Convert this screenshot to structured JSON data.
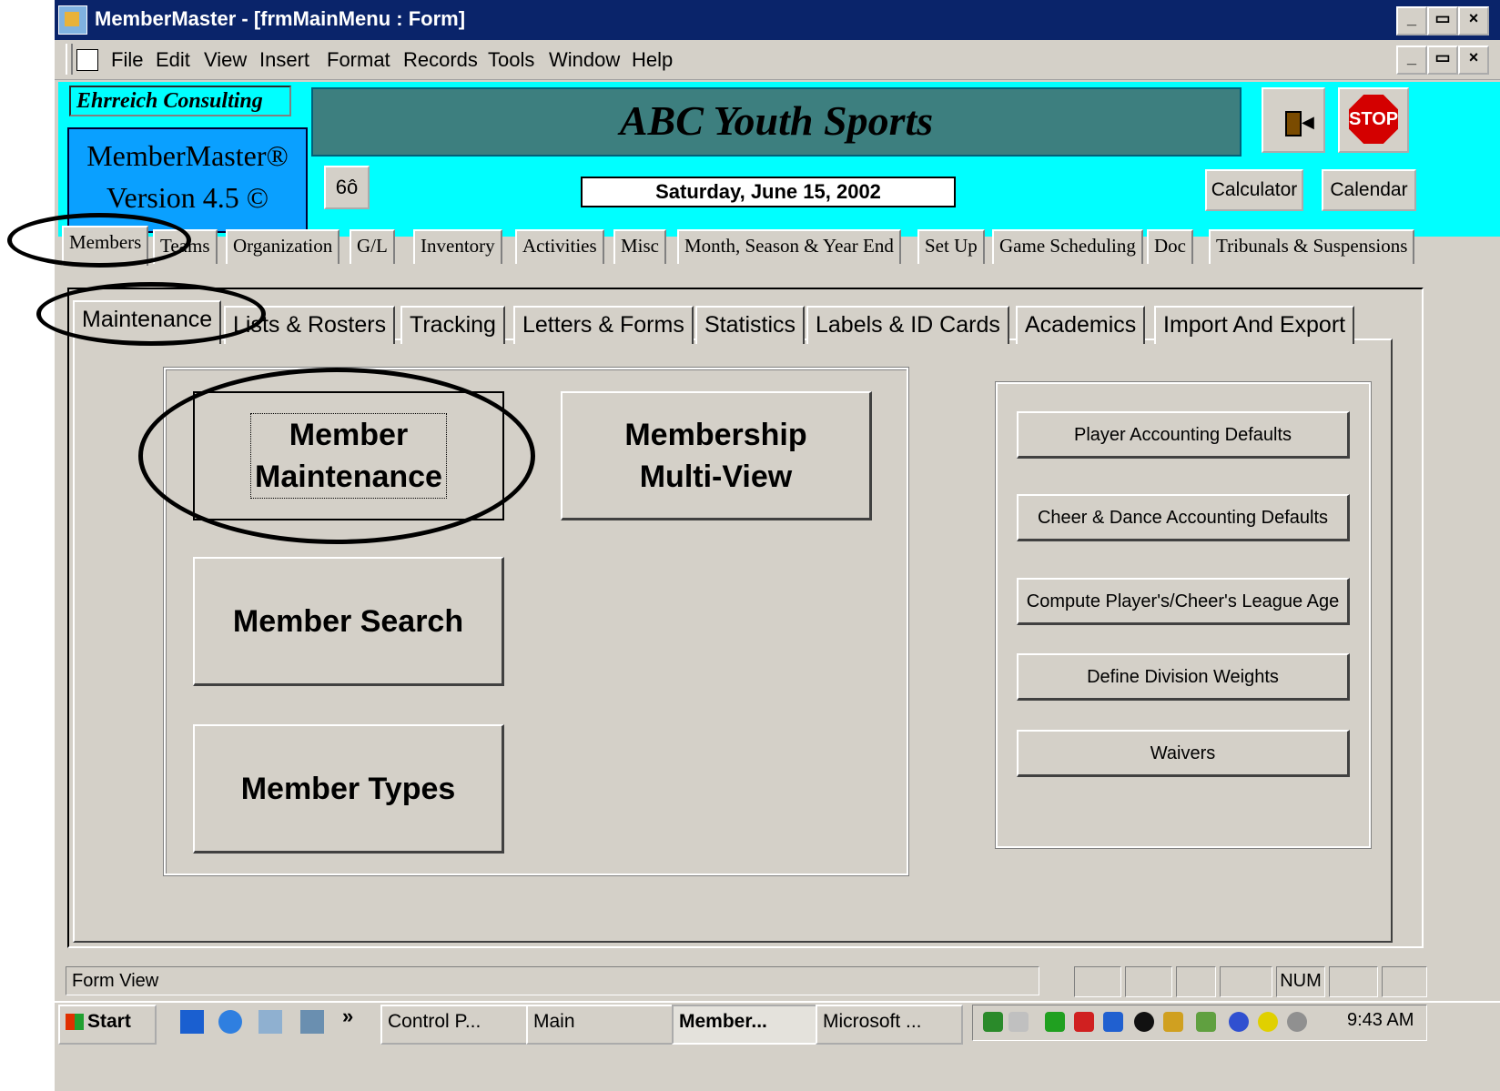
{
  "window": {
    "title": "MemberMaster - [frmMainMenu : Form]",
    "controls": [
      "_",
      "ȩ",
      "×"
    ]
  },
  "menubar": {
    "items": [
      "File",
      "Edit",
      "View",
      "Insert",
      "Format",
      "Records",
      "Tools",
      "Window",
      "Help"
    ]
  },
  "header": {
    "company": "Ehrreich Consulting",
    "product": "MemberMaster®",
    "version": "Version 4.5 ©",
    "banner": "ABC Youth Sports",
    "date": "Saturday, June 15, 2002",
    "glasses_label": "6ô",
    "stop_label": "STOP",
    "calculator_label": "Calculator",
    "calendar_label": "Calendar",
    "accent_color": "#00ffff"
  },
  "main_tabs": [
    "Members",
    "Teams",
    "Organization",
    "G/L",
    "Inventory",
    "Activities",
    "Misc",
    "Month, Season & Year End",
    "Set Up",
    "Game Scheduling",
    "Doc",
    "Tribunals & Suspensions"
  ],
  "sub_tabs": [
    "Maintenance",
    "Lists & Rosters",
    "Tracking",
    "Letters & Forms",
    "Statistics",
    "Labels & ID Cards",
    "Academics",
    "Import And Export"
  ],
  "big_buttons": {
    "member_maintenance": [
      "Member",
      "Maintenance"
    ],
    "membership_multiview": [
      "Membership",
      "Multi-View"
    ],
    "member_search": "Member Search",
    "member_types": "Member Types"
  },
  "right_buttons": [
    "Player Accounting Defaults",
    "Cheer & Dance Accounting Defaults",
    "Compute Player's/Cheer's League Age",
    "Define Division Weights",
    "Waivers"
  ],
  "statusbar": {
    "text": "Form View",
    "num": "NUM"
  },
  "taskbar": {
    "start": "Start",
    "chevron": "»",
    "tasks": [
      "Control P...",
      "Main",
      "Member...",
      "Microsoft ..."
    ],
    "clock": "9:43 AM"
  }
}
